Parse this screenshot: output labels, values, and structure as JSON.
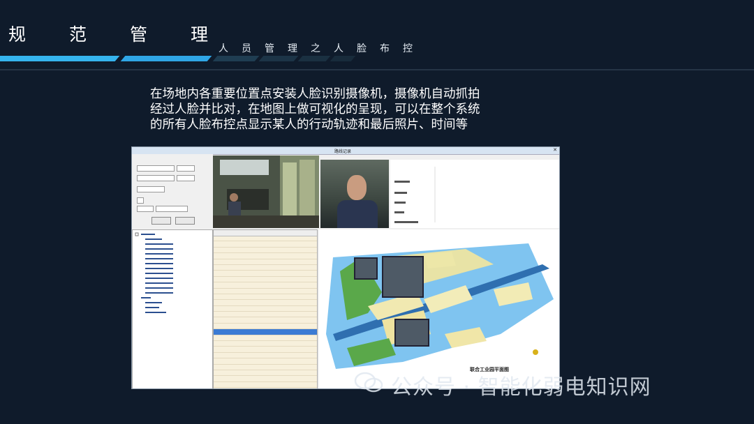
{
  "header": {
    "title": "规范管理",
    "subtitle": "人员管理之人脸布控",
    "accent": "#2fa6e6"
  },
  "description": {
    "lines": [
      "在场地内各重要位置点安装人脸识别摄像机，摄像机自动抓拍",
      "经过人脸并比对，在地图上做可视化的呈现，可以在整个系统",
      "的所有人脸布控点显示某人的行动轨迹和最后照片、时间等"
    ]
  },
  "app": {
    "window_title": "路线记录",
    "map_title": "联合工业园平面图"
  },
  "watermark": {
    "text": "公众号 · 智能化弱电知识网",
    "icon": "wechat-icon"
  }
}
